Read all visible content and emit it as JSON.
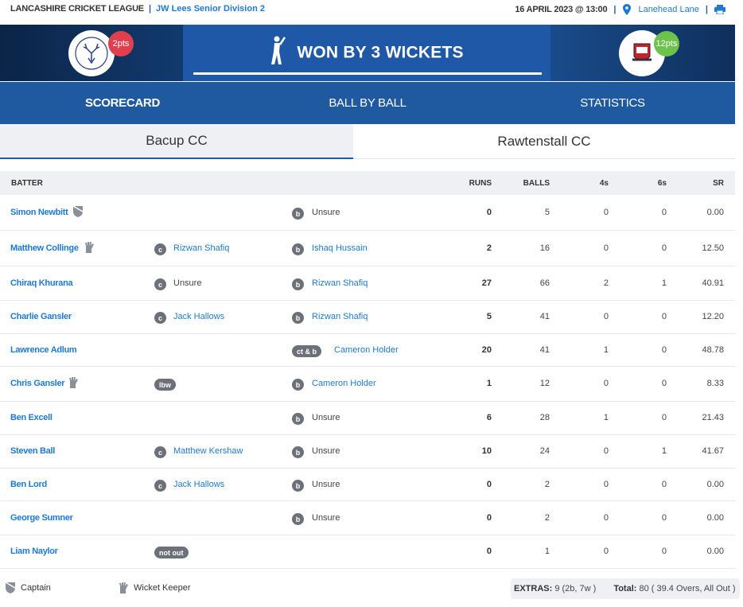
{
  "header": {
    "league": "LANCASHIRE CRICKET LEAGUE",
    "separator": "|",
    "division": "JW Lees Senior Division 2",
    "datetime": "16 APRIL 2023 @ 13:00",
    "venue": "Lanehead Lane"
  },
  "banner": {
    "home_points": "2pts",
    "away_points": "12pts",
    "result": "WON BY 3 WICKETS"
  },
  "nav": {
    "tabs": [
      "SCORECARD",
      "BALL BY BALL",
      "STATISTICS"
    ]
  },
  "teams": {
    "home": "Bacup CC",
    "away": "Rawtenstall CC"
  },
  "table": {
    "headers": {
      "batter": "BATTER",
      "runs": "RUNS",
      "balls": "BALLS",
      "fours": "4s",
      "sixes": "6s",
      "sr": "SR"
    },
    "rows": [
      {
        "name": "Simon Newbitt",
        "role": "captain",
        "f1_icon": "",
        "f1_name": "",
        "f1_link": false,
        "f2_icon": "b",
        "f2_name": "Unsure",
        "f2_link": false,
        "runs": "0",
        "balls": "5",
        "fours": "0",
        "sixes": "0",
        "sr": "0.00"
      },
      {
        "name": "Matthew Collinge",
        "role": "keeper",
        "f1_icon": "c",
        "f1_name": "Rizwan Shafiq",
        "f1_link": true,
        "f2_icon": "b",
        "f2_name": "Ishaq Hussain",
        "f2_link": true,
        "runs": "2",
        "balls": "16",
        "fours": "0",
        "sixes": "0",
        "sr": "12.50"
      },
      {
        "name": "Chiraq Khurana",
        "role": "",
        "f1_icon": "c",
        "f1_name": "Unsure",
        "f1_link": false,
        "f2_icon": "b",
        "f2_name": "Rizwan Shafiq",
        "f2_link": true,
        "runs": "27",
        "balls": "66",
        "fours": "2",
        "sixes": "1",
        "sr": "40.91"
      },
      {
        "name": "Charlie Gansler",
        "role": "",
        "f1_icon": "c",
        "f1_name": "Jack Hallows",
        "f1_link": true,
        "f2_icon": "b",
        "f2_name": "Rizwan Shafiq",
        "f2_link": true,
        "runs": "5",
        "balls": "41",
        "fours": "0",
        "sixes": "0",
        "sr": "12.20"
      },
      {
        "name": "Lawrence Adlum",
        "role": "",
        "f1_icon": "",
        "f1_name": "",
        "f1_link": false,
        "f2_icon": "ct & b",
        "f2_name": "Cameron Holder",
        "f2_link": true,
        "runs": "20",
        "balls": "41",
        "fours": "1",
        "sixes": "0",
        "sr": "48.78"
      },
      {
        "name": "Chris Gansler",
        "role": "keeper",
        "f1_icon": "lbw",
        "f1_name": "",
        "f1_link": false,
        "f2_icon": "b",
        "f2_name": "Cameron Holder",
        "f2_link": true,
        "runs": "1",
        "balls": "12",
        "fours": "0",
        "sixes": "0",
        "sr": "8.33"
      },
      {
        "name": "Ben Excell",
        "role": "",
        "f1_icon": "",
        "f1_name": "",
        "f1_link": false,
        "f2_icon": "b",
        "f2_name": "Unsure",
        "f2_link": false,
        "runs": "6",
        "balls": "28",
        "fours": "1",
        "sixes": "0",
        "sr": "21.43"
      },
      {
        "name": "Steven Ball",
        "role": "",
        "f1_icon": "c",
        "f1_name": "Matthew Kershaw",
        "f1_link": true,
        "f2_icon": "b",
        "f2_name": "Unsure",
        "f2_link": false,
        "runs": "10",
        "balls": "24",
        "fours": "0",
        "sixes": "1",
        "sr": "41.67"
      },
      {
        "name": "Ben Lord",
        "role": "",
        "f1_icon": "c",
        "f1_name": "Jack Hallows",
        "f1_link": true,
        "f2_icon": "b",
        "f2_name": "Unsure",
        "f2_link": false,
        "runs": "0",
        "balls": "2",
        "fours": "0",
        "sixes": "0",
        "sr": "0.00"
      },
      {
        "name": "George Sumner",
        "role": "",
        "f1_icon": "",
        "f1_name": "",
        "f1_link": false,
        "f2_icon": "b",
        "f2_name": "Unsure",
        "f2_link": false,
        "runs": "0",
        "balls": "2",
        "fours": "0",
        "sixes": "0",
        "sr": "0.00"
      },
      {
        "name": "Liam Naylor",
        "role": "",
        "f1_icon": "not out",
        "f1_name": "",
        "f1_link": false,
        "f2_icon": "",
        "f2_name": "",
        "f2_link": false,
        "runs": "0",
        "balls": "1",
        "fours": "0",
        "sixes": "0",
        "sr": "0.00"
      }
    ]
  },
  "footer": {
    "captain_label": "Captain",
    "keeper_label": "Wicket Keeper",
    "extras_label": "EXTRAS:",
    "extras_value": "9 (2b, 7w )",
    "total_label": "Total:",
    "total_value": "80 ( 39.4 Overs, All Out )"
  },
  "colors": {
    "accent": "#1f5aa0",
    "link": "#1d7ad0",
    "home_pts": "#e0404e",
    "away_pts": "#6cc24a"
  },
  "icons": {
    "venue": "map-pin-icon",
    "print": "printer-icon",
    "captain": "shield-icon",
    "keeper": "glove-icon",
    "result": "batter-icon"
  }
}
